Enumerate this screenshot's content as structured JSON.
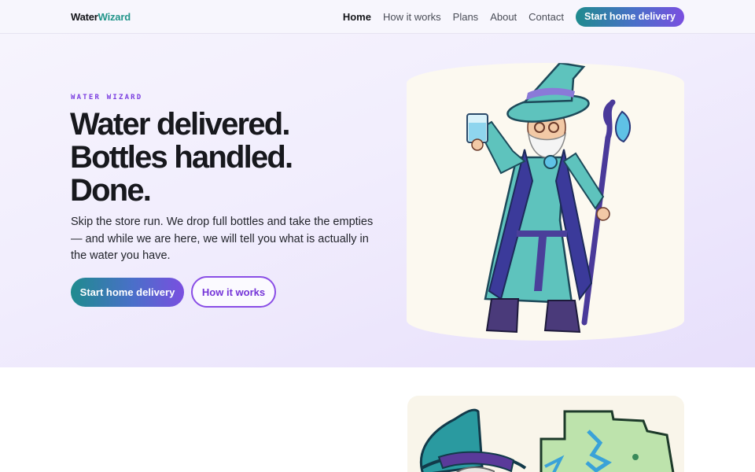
{
  "nav": {
    "logo_part1": "Water",
    "logo_part2": "Wizard",
    "links": [
      "Home",
      "How it works",
      "Plans",
      "About",
      "Contact"
    ],
    "active": "Home",
    "cta": "Start home delivery"
  },
  "hero": {
    "eyebrow": "WATER WIZARD",
    "headline": "Water delivered. Bottles handled. Done.",
    "subtext": "Skip the store run. We drop full bottles and take the empties — and while we are here, we will tell you what is actually in the water you have.",
    "primary_cta": "Start home delivery",
    "secondary_cta": "How it works",
    "illustration": "wizard-with-water-glass-and-staff"
  },
  "section2": {
    "illustration": "wizard-with-water-map"
  },
  "colors": {
    "brand_teal": "#22958a",
    "accent_purple": "#7b3fe0",
    "gradient_start": "#1f8b8e",
    "gradient_end": "#7a4fe0",
    "hero_bg": "#f1edfd"
  }
}
